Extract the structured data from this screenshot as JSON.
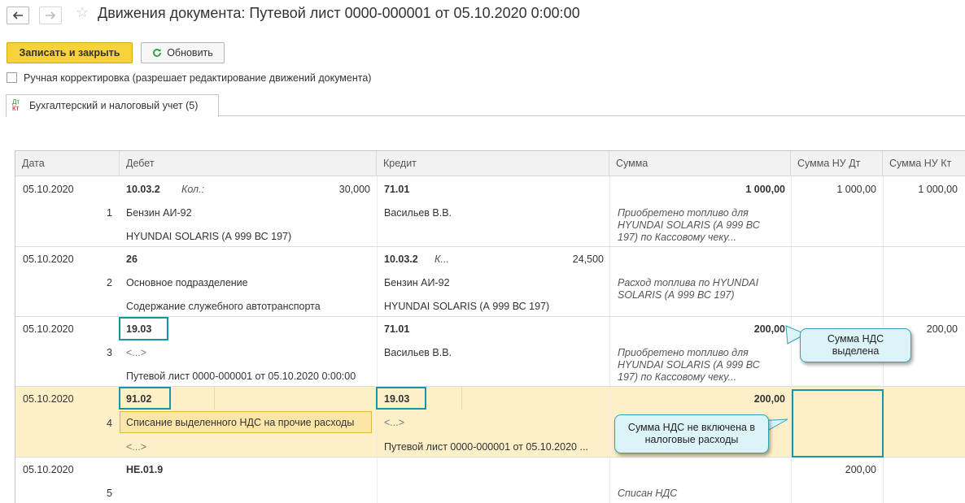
{
  "header": {
    "back_icon": "arrow-left-icon",
    "forward_icon": "arrow-right-icon",
    "favorite_icon": "star-icon",
    "title": "Движения документа: Путевой лист 0000-000001 от 05.10.2020 0:00:00"
  },
  "toolbar": {
    "save_close_label": "Записать и закрыть",
    "refresh_label": "Обновить",
    "refresh_icon": "refresh-icon"
  },
  "manual_edit": {
    "checked": false,
    "label": "Ручная корректировка (разрешает редактирование движений документа)"
  },
  "tab": {
    "icon_top": "Дт",
    "icon_bottom": "Кт",
    "label": "Бухгалтерский и налоговый учет (5)"
  },
  "table": {
    "columns": [
      "Дата",
      "Дебет",
      "Кредит",
      "Сумма",
      "Сумма НУ Дт",
      "Сумма НУ Кт"
    ],
    "rows": [
      {
        "date": "05.10.2020",
        "num": "1",
        "debit_account": "10.03.2",
        "debit_qty_label": "Кол.:",
        "debit_qty": "30,000",
        "debit_sub1": "Бензин АИ-92",
        "debit_sub2": "HYUNDAI SOLARIS (А 999 ВС 197)",
        "credit_account": "71.01",
        "credit_sub1": "Васильев В.В.",
        "credit_sub2": "",
        "sum": "1 000,00",
        "nu_dt": "1 000,00",
        "nu_kt": "1 000,00",
        "content_1": "Приобретено топливо для",
        "content_2": "HYUNDAI SOLARIS (А 999 ВС",
        "content_3": "197) по Кассовому чеку..."
      },
      {
        "date": "05.10.2020",
        "num": "2",
        "debit_account": "26",
        "debit_sub1": "Основное подразделение",
        "debit_sub2": "Содержание служебного автотранспорта",
        "credit_account": "10.03.2",
        "credit_qty_label": "К...",
        "credit_qty": "24,500",
        "credit_sub1": "Бензин АИ-92",
        "credit_sub2": "HYUNDAI SOLARIS (А 999 ВС 197)",
        "content_1": "Расход топлива по HYUNDAI",
        "content_2": "SOLARIS (А 999 ВС 197)"
      },
      {
        "date": "05.10.2020",
        "num": "3",
        "debit_account": "19.03",
        "debit_sub1": "<...>",
        "debit_sub2": "Путевой лист 0000-000001 от 05.10.2020 0:00:00",
        "credit_account": "71.01",
        "credit_sub1": "Васильев В.В.",
        "sum": "200,00",
        "nu_kt": "200,00",
        "content_1": "Приобретено топливо для",
        "content_2": "HYUNDAI SOLARIS (А 999 ВС",
        "content_3": "197) по Кассовому чеку..."
      },
      {
        "date": "05.10.2020",
        "num": "4",
        "debit_account": "91.02",
        "debit_sub1": "Списание выделенного НДС на прочие расходы",
        "debit_sub2": "<...>",
        "credit_account": "19.03",
        "credit_sub1": "<...>",
        "credit_sub2": "Путевой лист 0000-000001 от 05.10.2020 ...",
        "sum": "200,00"
      },
      {
        "date": "05.10.2020",
        "num": "5",
        "debit_account": "НЕ.01.9",
        "nu_dt": "200,00",
        "content_1": "Списан НДС"
      }
    ]
  },
  "callouts": {
    "vat_allocated": "Сумма НДС выделена",
    "vat_not_included": "Сумма НДС не включена в налоговые расходы"
  },
  "colors": {
    "primary_button": "#f8d23a",
    "highlight_row": "#fdf0c8",
    "annotation_border": "#1596a7",
    "callout_fill": "#dcf4f8"
  }
}
